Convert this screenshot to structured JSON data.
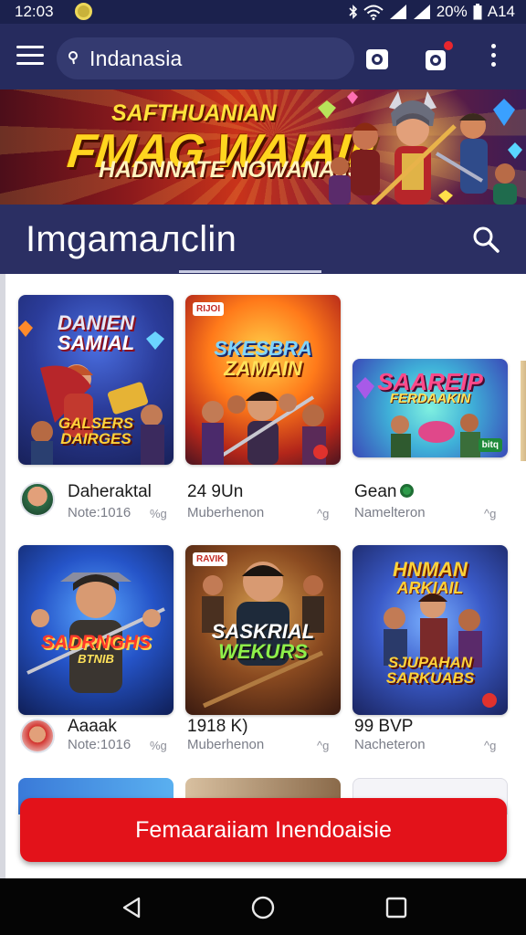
{
  "status_bar": {
    "time": "12:03",
    "battery": "20%",
    "carrier": "A14"
  },
  "search": {
    "value": "Indanasia"
  },
  "banner": {
    "line1": "SAFTHUANIAN",
    "line2": "FMAG WAIAII!",
    "line3": "HADNNATE NOWANAIIS"
  },
  "section": {
    "title": "Imgamaлclin"
  },
  "cards": [
    {
      "art": [
        "DANIEN",
        "SAMIAL"
      ],
      "art_bottom": "GALSERS DAIRGES",
      "name": "Daheraktal",
      "sub": "Note:1016",
      "extra": "%g"
    },
    {
      "tag": "RIJOI",
      "art": [
        "SKESBRA",
        "ZAMAIN"
      ],
      "name": "24 9Un",
      "sub": "Muberhenon",
      "extra": "^g"
    },
    {
      "art": [
        "SAAREIP",
        "FERDAAKIN"
      ],
      "tag": "bitq",
      "name": "Gean",
      "sub": "Namelteron",
      "extra": "^g"
    },
    {
      "art": [
        "SADRNGHS",
        "BTNIB"
      ],
      "name": "Aaaak",
      "sub": "Note:1016",
      "extra": "%g"
    },
    {
      "tag": "RAVIK",
      "art": [
        "SASKRIAL",
        "WEKURS"
      ],
      "name": "1918 K)",
      "sub": "Muberhenon",
      "extra": "^g"
    },
    {
      "art": [
        "HNMAN",
        "ARKIAIL"
      ],
      "art_bottom": "SJUPAHAN SARKUABS",
      "name": "99 BVP",
      "sub": "Nacheteron",
      "extra": "^g"
    }
  ],
  "cta": {
    "label": "Femaaraiiam Inendoaisie"
  },
  "colors": {
    "header": "#262b5e",
    "section": "#2b2f63",
    "cta": "#e3121a"
  }
}
